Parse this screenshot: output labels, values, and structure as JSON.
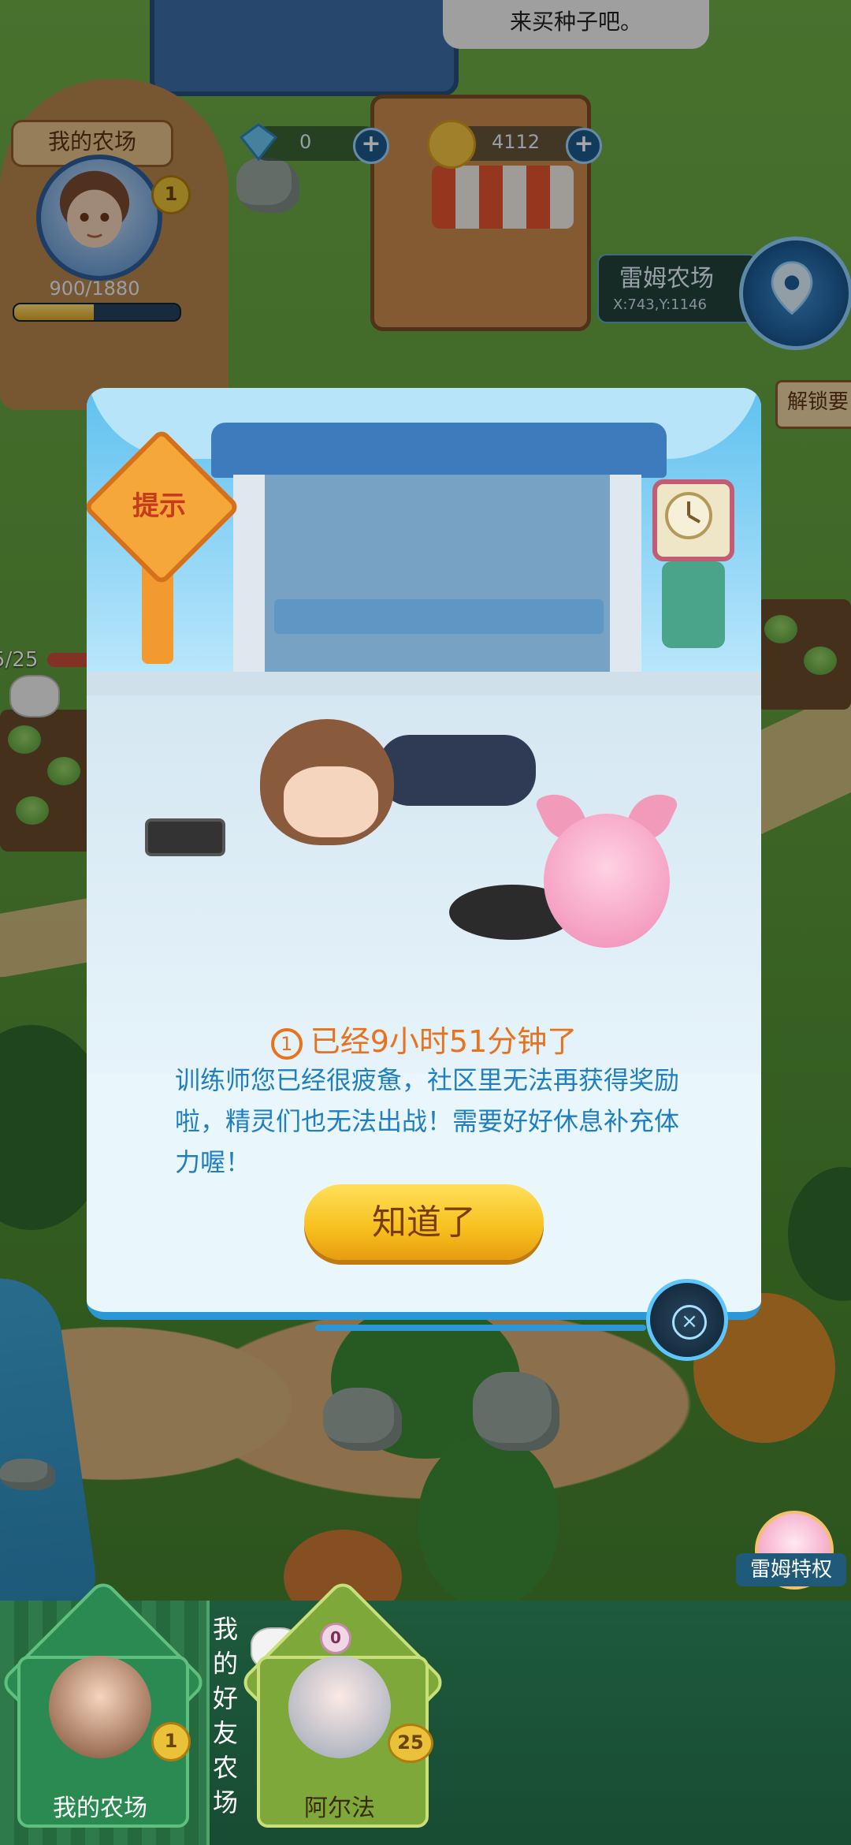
{
  "top": {
    "speech_text": "来买种子吧。",
    "gems_value": "0",
    "coins_value": "4112",
    "plus_symbol": "+"
  },
  "profile": {
    "farm_label": "我的农场",
    "level": "1",
    "xp_text": "900/1880",
    "xp_progress": 0.4787
  },
  "location": {
    "name": "雷姆农场",
    "coords": "X:743,Y:1146",
    "unlock_text": "解锁要"
  },
  "side": {
    "count_text": "5/25"
  },
  "dialog": {
    "sign_text": "提示",
    "tip_icon": "1",
    "tip_title": "已经9小时51分钟了",
    "tip_body": "训练师您已经很疲惫，社区里无法再获得奖励啦，精灵们也无法出战！需要好好休息补充体力喔！",
    "ok_button": "知道了",
    "close_symbol": "×"
  },
  "privilege": {
    "label": "雷姆特权"
  },
  "bottom_bar": {
    "my_farm": {
      "label": "我的农场",
      "level": "1"
    },
    "friends_label": "我的好友农场",
    "friends": [
      {
        "name": "阿尔法",
        "level": "25",
        "badge": "0"
      }
    ]
  },
  "colors": {
    "accent_blue": "#2c97d6",
    "tip_orange": "#e8721e",
    "body_blue": "#1f7fc0",
    "button_yellow": "#f7bf1d"
  }
}
